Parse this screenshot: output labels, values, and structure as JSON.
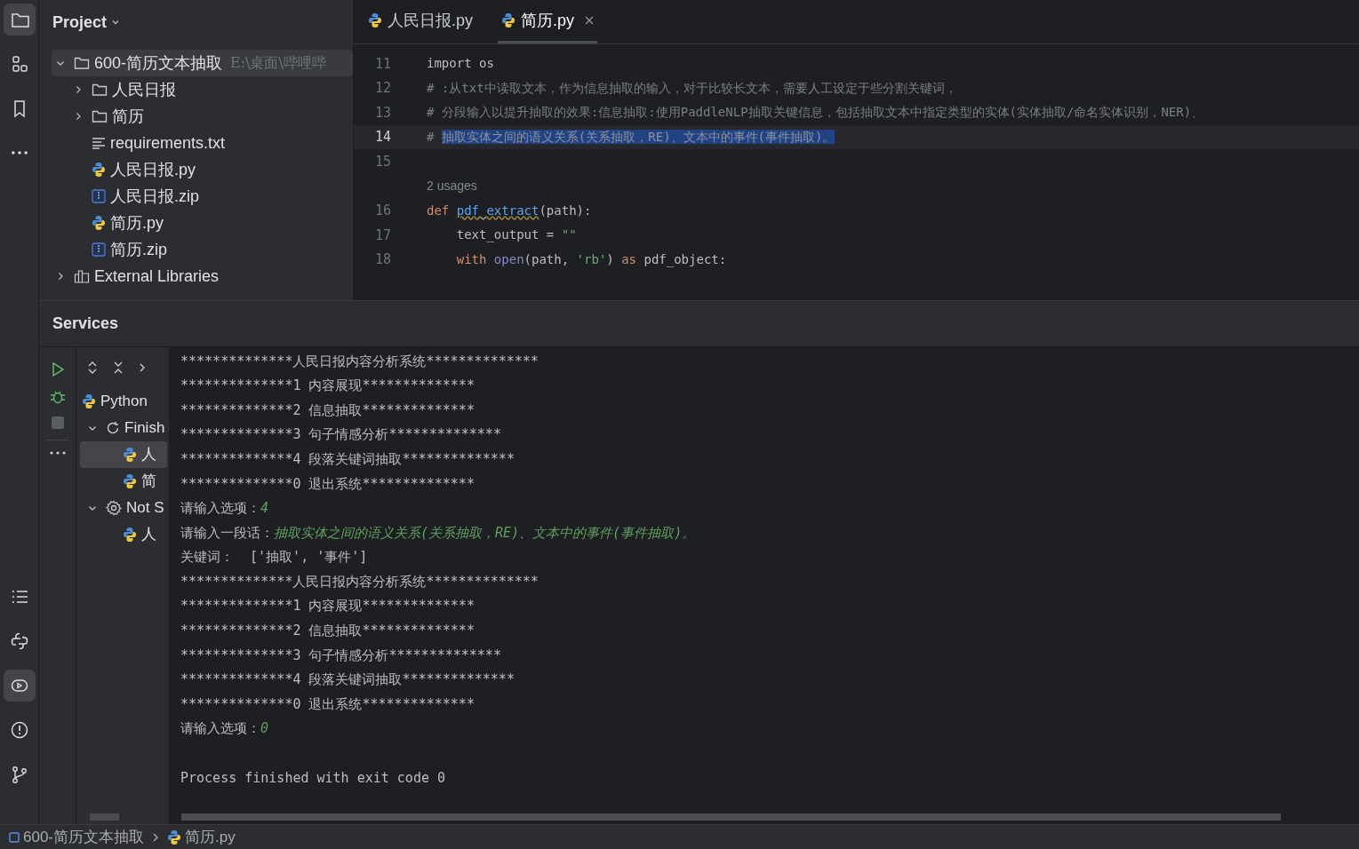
{
  "project_panel": {
    "title": "Project",
    "tree": [
      {
        "label": "600-简历文本抽取",
        "path": "E:\\桌面\\哔哩哔",
        "kind": "folder",
        "expanded": true,
        "selected": true,
        "children": [
          {
            "label": "人民日报",
            "kind": "folder",
            "expanded": false,
            "selected": false
          },
          {
            "label": "简历",
            "kind": "folder",
            "expanded": false,
            "selected": false
          },
          {
            "label": "requirements.txt",
            "kind": "text",
            "selected": false
          },
          {
            "label": "人民日报.py",
            "kind": "python",
            "selected": false
          },
          {
            "label": "人民日报.zip",
            "kind": "zip",
            "selected": false
          },
          {
            "label": "简历.py",
            "kind": "python",
            "selected": false
          },
          {
            "label": "简历.zip",
            "kind": "zip",
            "selected": false
          }
        ]
      },
      {
        "label": "External Libraries",
        "kind": "library",
        "expanded": false,
        "selected": false
      }
    ]
  },
  "editor": {
    "tabs": [
      {
        "label": "人民日报.py",
        "selected": false
      },
      {
        "label": "简历.py",
        "selected": true,
        "closable": true
      }
    ],
    "lines": [
      {
        "number": "11",
        "current": false,
        "segments": [
          {
            "kind": "text",
            "text": "import os"
          }
        ]
      },
      {
        "number": "12",
        "current": false,
        "segments": [
          {
            "kind": "comment",
            "text": "# :从txt中读取文本，作为信息抽取的输入，对于比较长文本，需要人工设定于些分割关键词，"
          }
        ]
      },
      {
        "number": "13",
        "current": false,
        "segments": [
          {
            "kind": "comment",
            "text": "# 分段输入以提升抽取的效果:信息抽取:使用PaddleNLP抽取关键信息，包括抽取文本中指定类型的实体(实体抽取/命名实体识别，NER)、"
          }
        ]
      },
      {
        "number": "14",
        "current": true,
        "segments": [
          {
            "kind": "comment",
            "text": "# "
          },
          {
            "kind": "selection",
            "text": "抽取实体之间的语义关系(关系抽取，RE)、文本中的事件(事件抽取)。"
          }
        ]
      },
      {
        "number": "15",
        "current": false
      },
      {
        "kind": "hint",
        "text": "2 usages"
      },
      {
        "number": "16",
        "current": false,
        "segments": [
          {
            "kind": "keyword",
            "text": "def "
          },
          {
            "kind": "function",
            "text": "pdf_extract"
          },
          {
            "kind": "text",
            "text": "(path):"
          }
        ]
      },
      {
        "number": "17",
        "current": false,
        "segments": [
          {
            "kind": "text",
            "text": "    text_output = "
          },
          {
            "kind": "string",
            "text": "\"\""
          }
        ]
      },
      {
        "number": "18",
        "current": false,
        "segments": [
          {
            "kind": "keyword",
            "text": "    with "
          },
          {
            "kind": "builtin",
            "text": "open"
          },
          {
            "kind": "text",
            "text": "(path, "
          },
          {
            "kind": "string",
            "text": "'rb'"
          },
          {
            "kind": "text",
            "text": ") "
          },
          {
            "kind": "keyword",
            "text": "as "
          },
          {
            "kind": "text",
            "text": "pdf_object:"
          }
        ]
      }
    ]
  },
  "services": {
    "title": "Services",
    "tree": [
      {
        "label": "Python",
        "kind": "python",
        "selected": false,
        "children": [
          {
            "label": "Finish",
            "kind": "refresh",
            "expanded": true,
            "selected": false,
            "children": [
              {
                "label": "人",
                "kind": "python",
                "selected": true
              },
              {
                "label": "简",
                "kind": "python",
                "selected": false
              }
            ]
          },
          {
            "label": "Not S",
            "kind": "gear",
            "expanded": true,
            "selected": false,
            "children": [
              {
                "label": "人",
                "kind": "python",
                "selected": false
              }
            ]
          }
        ]
      }
    ],
    "console": [
      [
        {
          "kind": "output",
          "text": "**************人民日报内容分析系统**************"
        }
      ],
      [
        {
          "kind": "output",
          "text": "**************1 内容展现**************"
        }
      ],
      [
        {
          "kind": "output",
          "text": "**************2 信息抽取**************"
        }
      ],
      [
        {
          "kind": "output",
          "text": "**************3 句子情感分析**************"
        }
      ],
      [
        {
          "kind": "output",
          "text": "**************4 段落关键词抽取**************"
        }
      ],
      [
        {
          "kind": "output",
          "text": "**************0 退出系统**************"
        }
      ],
      [
        {
          "kind": "output",
          "text": "请输入选项："
        },
        {
          "kind": "input",
          "text": "4"
        }
      ],
      [
        {
          "kind": "output",
          "text": "请输入一段话："
        },
        {
          "kind": "input",
          "text": "抽取实体之间的语义关系(关系抽取，RE)、文本中的事件(事件抽取)。"
        }
      ],
      [
        {
          "kind": "output",
          "text": "关键词：  ['抽取', '事件']"
        }
      ],
      [
        {
          "kind": "output",
          "text": "**************人民日报内容分析系统**************"
        }
      ],
      [
        {
          "kind": "output",
          "text": "**************1 内容展现**************"
        }
      ],
      [
        {
          "kind": "output",
          "text": "**************2 信息抽取**************"
        }
      ],
      [
        {
          "kind": "output",
          "text": "**************3 句子情感分析**************"
        }
      ],
      [
        {
          "kind": "output",
          "text": "**************4 段落关键词抽取**************"
        }
      ],
      [
        {
          "kind": "output",
          "text": "**************0 退出系统**************"
        }
      ],
      [
        {
          "kind": "output",
          "text": "请输入选项："
        },
        {
          "kind": "input",
          "text": "0"
        }
      ],
      [
        {
          "kind": "blank-line"
        }
      ],
      [
        {
          "kind": "output",
          "text": "Process finished with exit code 0"
        }
      ]
    ]
  },
  "status_bar": {
    "breadcrumbs": [
      {
        "label": "600-简历文本抽取",
        "kind": "module"
      },
      {
        "label": "简历.py",
        "kind": "python"
      }
    ]
  },
  "tool_strip": {
    "top": [
      {
        "kind": "folder",
        "selected": true
      },
      {
        "kind": "structure",
        "selected": false
      },
      {
        "kind": "bookmark",
        "selected": false
      },
      {
        "kind": "more",
        "selected": false
      }
    ],
    "bottom": [
      {
        "kind": "list",
        "selected": false
      },
      {
        "kind": "python-console",
        "selected": false
      },
      {
        "kind": "services",
        "selected": true
      },
      {
        "kind": "problems",
        "selected": false
      },
      {
        "kind": "git",
        "selected": false
      }
    ]
  }
}
